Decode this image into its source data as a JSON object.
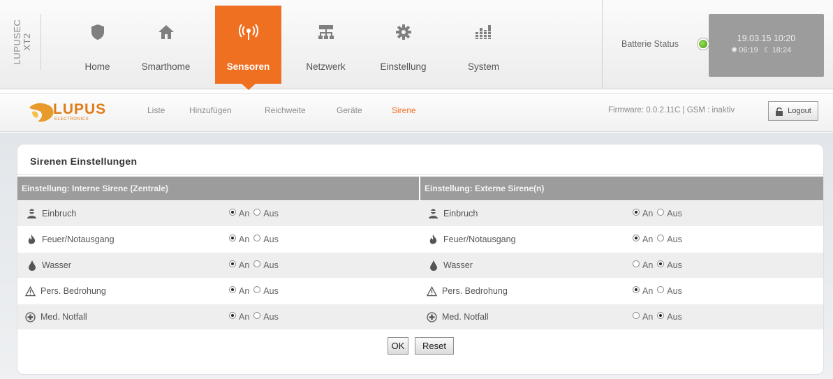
{
  "brand": {
    "line1": "LUPUSEC",
    "line2": "XT2"
  },
  "nav": [
    {
      "label": "Home",
      "icon": "shield-icon"
    },
    {
      "label": "Smarthome",
      "icon": "house-icon"
    },
    {
      "label": "Sensoren",
      "icon": "signal-icon",
      "active": true
    },
    {
      "label": "Netzwerk",
      "icon": "network-icon"
    },
    {
      "label": "Einstellung",
      "icon": "gear-icon"
    },
    {
      "label": "System",
      "icon": "equalizer-icon"
    }
  ],
  "status": {
    "battery_label": "Batterie Status",
    "battery_color": "#4caf1e",
    "datetime": "19.03.15 10:20",
    "sunrise": "06:19",
    "sunset": "18:24"
  },
  "logo": {
    "name": "LUPUS",
    "sub": "ELECTRONICS"
  },
  "subnav": [
    {
      "label": "Liste"
    },
    {
      "label": "Hinzufügen"
    },
    {
      "label": "Reichweite"
    },
    {
      "label": "Geräte"
    },
    {
      "label": "Sirene",
      "active": true
    }
  ],
  "firmware": "Firmware: 0.0.2.11C | GSM : inaktiv",
  "logout_label": "Logout",
  "panel": {
    "title": "Sirenen Einstellungen",
    "left_header": "Einstellung: Interne Sirene (Zentrale)",
    "right_header": "Einstellung: Externe Sirene(n)",
    "on_label": "An",
    "off_label": "Aus",
    "rows": [
      {
        "label": "Einbruch",
        "icon": "burglar-icon",
        "internal": "An",
        "external": "An"
      },
      {
        "label": "Feuer/Notausgang",
        "icon": "flame-icon",
        "internal": "An",
        "external": "An"
      },
      {
        "label": "Wasser",
        "icon": "water-drop-icon",
        "internal": "An",
        "external": "Aus"
      },
      {
        "label": "Pers. Bedrohung",
        "icon": "warning-icon",
        "internal": "An",
        "external": "An"
      },
      {
        "label": "Med. Notfall",
        "icon": "medical-cross-icon",
        "internal": "An",
        "external": "Aus"
      }
    ],
    "ok_label": "OK",
    "reset_label": "Reset"
  },
  "colors": {
    "accent": "#f07022",
    "header_gray": "#9c9c9c",
    "row_alt": "#eeeeee"
  }
}
